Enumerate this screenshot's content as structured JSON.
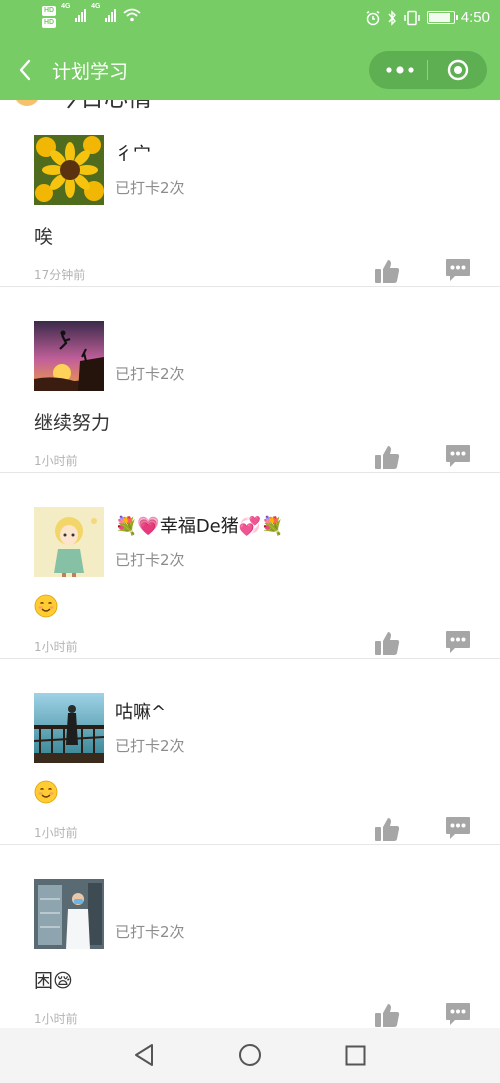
{
  "status_bar": {
    "hd1": "HD",
    "hd2": "HD",
    "net1": "4G",
    "net2": "4G",
    "time": "4:50",
    "icons": [
      "alarm-icon",
      "bluetooth-icon",
      "vibrate-icon",
      "battery-icon"
    ]
  },
  "nav": {
    "title": "计划学习",
    "icons": [
      "back-arrow-icon",
      "more-dots-icon",
      "close-target-icon"
    ]
  },
  "section": {
    "heading": "今日心情"
  },
  "cards": [
    {
      "name": "彳宀",
      "checkin": "已打卡2次",
      "content": "唉",
      "time": "17分钟前"
    },
    {
      "name": "",
      "checkin": "已打卡2次",
      "content": "继续努力",
      "time": "1小时前"
    },
    {
      "name": "💐💗幸福De猪💞💐",
      "checkin": "已打卡2次",
      "content": "😊",
      "time": "1小时前"
    },
    {
      "name": "咕嘛^",
      "checkin": "已打卡2次",
      "content": "😊",
      "time": "1小时前"
    },
    {
      "name": "",
      "checkin": "已打卡2次",
      "content": "困😪",
      "time": "1小时前"
    }
  ],
  "colors": {
    "header_green": "#77cc66",
    "capsule_green": "#5eae52",
    "icon_gray": "#a6a6a6",
    "meta_gray": "#8c8c8c"
  },
  "system_nav": {
    "icons": [
      "nav-back-triangle-icon",
      "nav-home-circle-icon",
      "nav-recent-square-icon"
    ]
  }
}
